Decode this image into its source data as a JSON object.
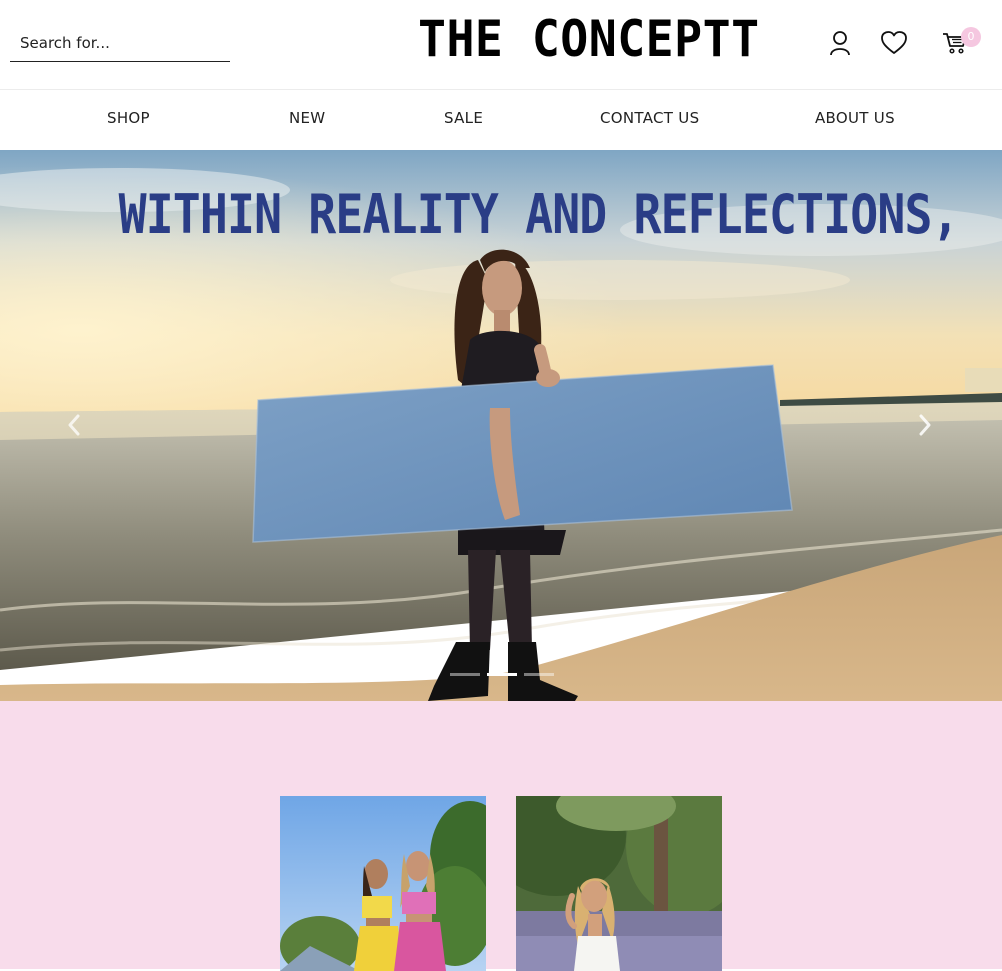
{
  "header": {
    "search": {
      "placeholder": "Search for..."
    },
    "logo_text": "THE CONCEPTT",
    "icons": [
      "user-icon",
      "heart-icon",
      "cart-icon"
    ],
    "cart_count": "0",
    "cart_badge_color": "#f5c7e0"
  },
  "nav": {
    "items": [
      {
        "label": "SHOP"
      },
      {
        "label": "NEW"
      },
      {
        "label": "SALE"
      },
      {
        "label": "CONTACT US"
      },
      {
        "label": "ABOUT US"
      }
    ]
  },
  "hero": {
    "headline": "WITHIN REALITY AND REFLECTIONS,",
    "headline_color": "#2a3d86",
    "slides_total": 3,
    "active_slide": 2,
    "prev_icon": "chevron-left-icon",
    "next_icon": "chevron-right-icon"
  },
  "collection": {
    "background_color": "#f8dceb",
    "cards": [
      {
        "image": "two-women-colorful-outfits-photo"
      },
      {
        "image": "woman-white-top-forest-photo"
      }
    ]
  }
}
